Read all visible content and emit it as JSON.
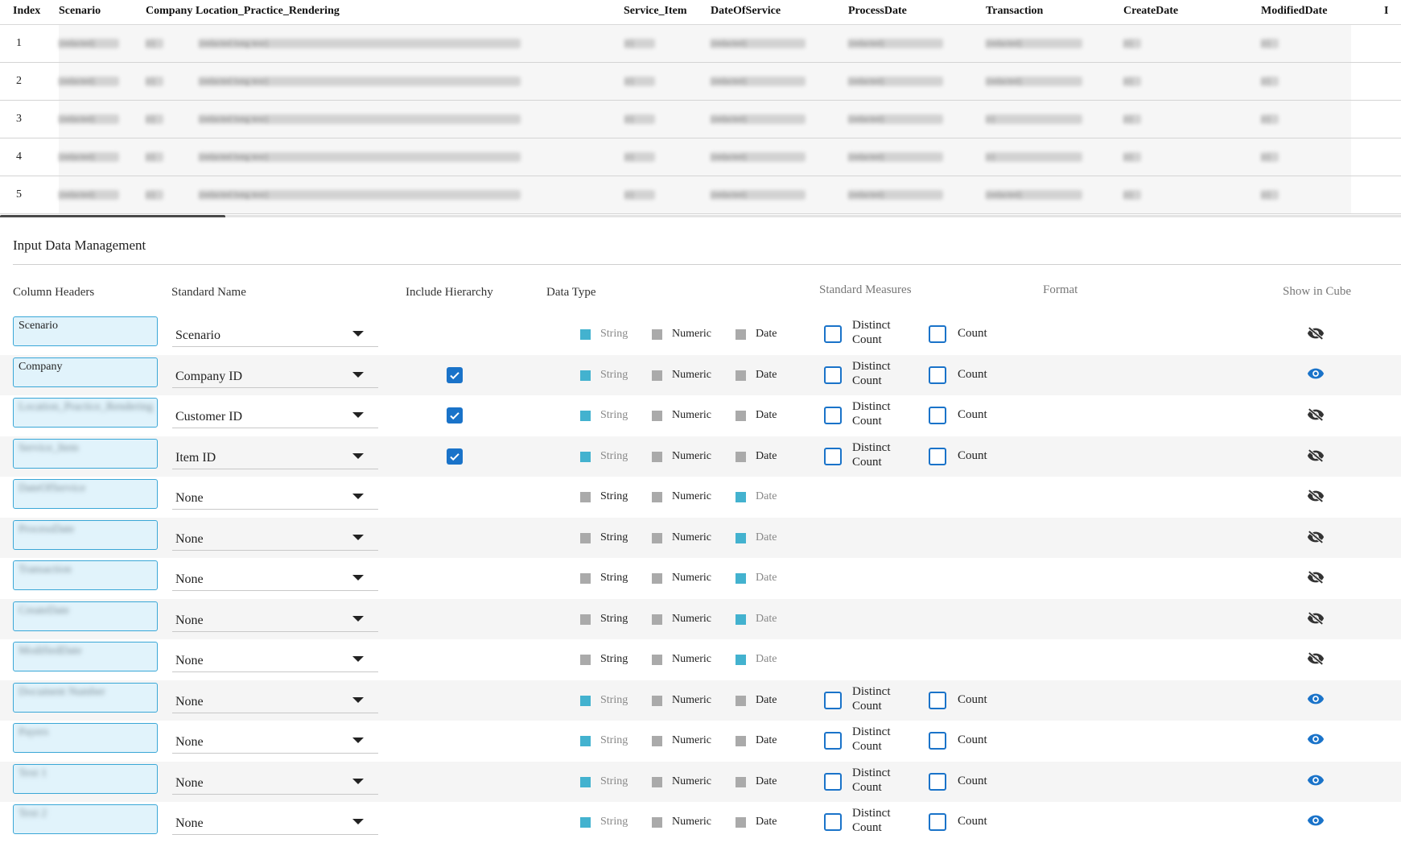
{
  "preview": {
    "headers": [
      "Index",
      "Scenario",
      "Company",
      "Location_Practice_Rendering",
      "Service_Item",
      "DateOfService",
      "ProcessDate",
      "Transaction",
      "CreateDate",
      "ModifiedDate",
      "I"
    ],
    "rows": [
      {
        "index": "1",
        "cells": [
          "[redacted]",
          "[r]",
          "[redacted long text]",
          "[r]",
          "[redacted]",
          "[redacted]",
          "[redacted]",
          "[r]",
          "[r]"
        ]
      },
      {
        "index": "2",
        "cells": [
          "[redacted]",
          "[r]",
          "[redacted long text]",
          "[r]",
          "[redacted]",
          "[redacted]",
          "[redacted]",
          "[r]",
          "[r]"
        ]
      },
      {
        "index": "3",
        "cells": [
          "[redacted]",
          "[r]",
          "[redacted long text]",
          "[r]",
          "[redacted]",
          "[redacted]",
          "[r]",
          "[r]",
          "[r]"
        ]
      },
      {
        "index": "4",
        "cells": [
          "[redacted]",
          "[r]",
          "[redacted long text]",
          "[r]",
          "[redacted]",
          "[redacted]",
          "[r]",
          "[r]",
          "[r]"
        ]
      },
      {
        "index": "5",
        "cells": [
          "[redacted]",
          "[r]",
          "[redacted long text]",
          "[r]",
          "[redacted]",
          "[redacted]",
          "[redacted]",
          "[r]",
          "[r]"
        ]
      }
    ]
  },
  "idm": {
    "title": "Input Data Management",
    "columns": {
      "headers": "Column Headers",
      "standard_name": "Standard Name",
      "include_hierarchy": "Include Hierarchy",
      "data_type": "Data Type",
      "standard_measures": "Standard Measures",
      "format": "Format",
      "show_in_cube": "Show in Cube"
    },
    "labels": {
      "string": "String",
      "numeric": "Numeric",
      "date": "Date",
      "distinct": "Distinct",
      "count_word": "Count",
      "count": "Count"
    },
    "rows": [
      {
        "header": "Scenario",
        "blurred": false,
        "standard": "Scenario",
        "hierarchy": "none",
        "type": "String",
        "measures": true,
        "visible": false
      },
      {
        "header": "Company",
        "blurred": false,
        "standard": "Company ID",
        "hierarchy": "checked",
        "type": "String",
        "measures": true,
        "visible": true
      },
      {
        "header": "Location_Practice_Rendering",
        "blurred": true,
        "standard": "Customer ID",
        "hierarchy": "checked",
        "type": "String",
        "measures": true,
        "visible": false
      },
      {
        "header": "Service_Item",
        "blurred": true,
        "standard": "Item ID",
        "hierarchy": "checked",
        "type": "String",
        "measures": true,
        "visible": false
      },
      {
        "header": "DateOfService",
        "blurred": true,
        "standard": "None",
        "hierarchy": "none",
        "type": "Date",
        "measures": false,
        "visible": false
      },
      {
        "header": "ProcessDate",
        "blurred": true,
        "standard": "None",
        "hierarchy": "none",
        "type": "Date",
        "measures": false,
        "visible": false
      },
      {
        "header": "Transaction",
        "blurred": true,
        "standard": "None",
        "hierarchy": "none",
        "type": "Date",
        "measures": false,
        "visible": false
      },
      {
        "header": "CreateDate",
        "blurred": true,
        "standard": "None",
        "hierarchy": "none",
        "type": "Date",
        "measures": false,
        "visible": false
      },
      {
        "header": "ModifiedDate",
        "blurred": true,
        "standard": "None",
        "hierarchy": "none",
        "type": "Date",
        "measures": false,
        "visible": false
      },
      {
        "header": "Document Number",
        "blurred": true,
        "standard": "None",
        "hierarchy": "none",
        "type": "String",
        "measures": true,
        "visible": true
      },
      {
        "header": "Payers",
        "blurred": true,
        "standard": "None",
        "hierarchy": "none",
        "type": "String",
        "measures": true,
        "visible": true
      },
      {
        "header": "Text 1",
        "blurred": true,
        "standard": "None",
        "hierarchy": "none",
        "type": "String",
        "measures": true,
        "visible": true
      },
      {
        "header": "Text 2",
        "blurred": true,
        "standard": "None",
        "hierarchy": "none",
        "type": "String",
        "measures": true,
        "visible": true
      }
    ],
    "colors": {
      "accent": "#1a73c9",
      "type_selected": "#43b2cf",
      "type_unselected": "#aaaaaa",
      "header_box": "#e1f3fb"
    }
  }
}
